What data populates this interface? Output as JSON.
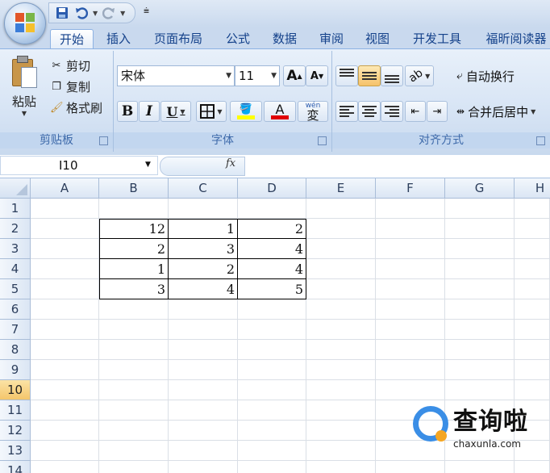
{
  "quick_access": {
    "undo_icon": "undo-icon",
    "redo_icon": "redo-icon",
    "save_icon": "save-icon"
  },
  "tabs": [
    "开始",
    "插入",
    "页面布局",
    "公式",
    "数据",
    "审阅",
    "视图",
    "开发工具",
    "福昕阅读器"
  ],
  "ribbon": {
    "clipboard": {
      "paste": "粘贴",
      "cut": "剪切",
      "copy": "复制",
      "format_painter": "格式刷",
      "group_label": "剪贴板"
    },
    "font": {
      "name": "宋体",
      "size": "11",
      "bold": "B",
      "italic": "I",
      "underline": "U",
      "grow": "A",
      "shrink": "A",
      "font_color_letter": "A",
      "phonetic": "wén",
      "group_label": "字体",
      "fill_color": "#ffff00",
      "font_color": "#e00000"
    },
    "alignment": {
      "wrap_text": "自动换行",
      "merge_center": "合并后居中",
      "group_label": "对齐方式"
    }
  },
  "formula_bar": {
    "name_box": "I10",
    "fx": "fx",
    "formula": ""
  },
  "columns": [
    "A",
    "B",
    "C",
    "D",
    "E",
    "F",
    "G",
    "H"
  ],
  "rows": [
    "1",
    "2",
    "3",
    "4",
    "5",
    "6",
    "7",
    "8",
    "9",
    "10",
    "11",
    "12",
    "13",
    "14"
  ],
  "selected_row": "10",
  "cells": [
    {
      "ref": "B2",
      "value": "12"
    },
    {
      "ref": "C2",
      "value": "1"
    },
    {
      "ref": "D2",
      "value": "2"
    },
    {
      "ref": "B3",
      "value": "2"
    },
    {
      "ref": "C3",
      "value": "3"
    },
    {
      "ref": "D3",
      "value": "4"
    },
    {
      "ref": "B4",
      "value": "1"
    },
    {
      "ref": "C4",
      "value": "2"
    },
    {
      "ref": "D4",
      "value": "4"
    },
    {
      "ref": "B5",
      "value": "3"
    },
    {
      "ref": "C5",
      "value": "4"
    },
    {
      "ref": "D5",
      "value": "5"
    }
  ],
  "watermark": {
    "title": "查询啦",
    "url": "chaxunla.com"
  }
}
